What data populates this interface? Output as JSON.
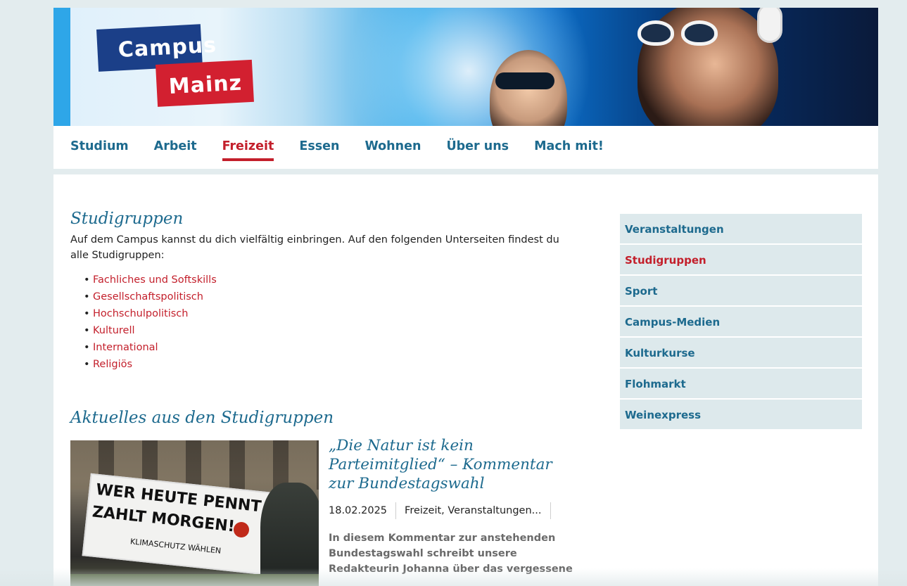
{
  "logo": {
    "line1": "Campus",
    "line2": "Mainz"
  },
  "nav": {
    "items": [
      {
        "label": "Studium"
      },
      {
        "label": "Arbeit"
      },
      {
        "label": "Freizeit",
        "active": true
      },
      {
        "label": "Essen"
      },
      {
        "label": "Wohnen"
      },
      {
        "label": "Über uns"
      },
      {
        "label": "Mach mit!"
      }
    ]
  },
  "main": {
    "title": "Studigruppen",
    "intro": "Auf dem Campus kannst du dich vielfältig einbringen. Auf den folgenden Unterseiten findest du alle Studigruppen:",
    "links": [
      "Fachliches und Softskills",
      "Gesellschaftspolitisch",
      "Hochschulpolitisch",
      "Kulturell",
      "International",
      "Religiös"
    ],
    "news_title": "Aktuelles aus den Studigruppen",
    "article": {
      "title": "„Die Natur ist kein Parteimitglied“ – Kommentar zur Bundestagswahl",
      "date": "18.02.2025",
      "categories": "Freizeit, Veranstaltungen...",
      "excerpt": "In diesem Kommentar zur anstehenden Bundestagswahl schreibt unsere Redakteurin Johanna über das vergessene",
      "image_text": {
        "line1": "WER HEUTE PENNT",
        "line2": "ZAHLT MORGEN!",
        "line3": "KLIMASCHUTZ WÄHLEN"
      }
    }
  },
  "sidebar": {
    "items": [
      {
        "label": "Veranstaltungen"
      },
      {
        "label": "Studigruppen",
        "active": true
      },
      {
        "label": "Sport"
      },
      {
        "label": "Campus-Medien"
      },
      {
        "label": "Kulturkurse"
      },
      {
        "label": "Flohmarkt"
      },
      {
        "label": "Weinexpress"
      }
    ]
  },
  "colors": {
    "primary_blue": "#1d6a8e",
    "accent_red": "#c31f2b",
    "logo_blue": "#1b3f88",
    "logo_red": "#d22030",
    "sidebar_bg": "#dde9ec"
  }
}
